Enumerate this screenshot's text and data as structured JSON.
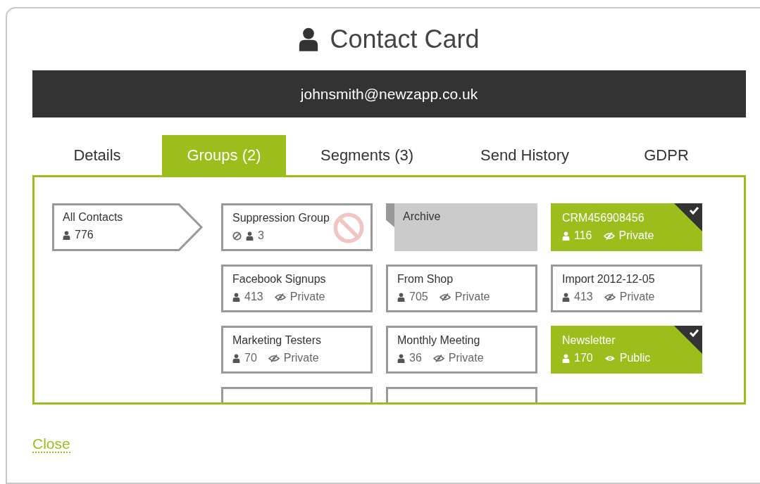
{
  "title": "Contact Card",
  "email": "johnsmith@newzapp.co.uk",
  "tabs": [
    {
      "label": "Details",
      "selected": false
    },
    {
      "label": "Groups (2)",
      "selected": true
    },
    {
      "label": "Segments (3)",
      "selected": false
    },
    {
      "label": "Send History",
      "selected": false
    },
    {
      "label": "GDPR",
      "selected": false
    }
  ],
  "all_contacts": {
    "name": "All Contacts",
    "count": "776"
  },
  "groups": [
    {
      "kind": "suppression",
      "name": "Suppression Group",
      "count": "3",
      "selected": false
    },
    {
      "kind": "archive",
      "name": "Archive"
    },
    {
      "kind": "group",
      "name": "CRM456908456",
      "count": "116",
      "visibility": "Private",
      "public": false,
      "selected": true
    },
    {
      "kind": "group",
      "name": "Facebook Signups",
      "count": "413",
      "visibility": "Private",
      "public": false,
      "selected": false
    },
    {
      "kind": "group",
      "name": "From Shop",
      "count": "705",
      "visibility": "Private",
      "public": false,
      "selected": false
    },
    {
      "kind": "group",
      "name": "Import 2012-12-05",
      "count": "413",
      "visibility": "Private",
      "public": false,
      "selected": false
    },
    {
      "kind": "group",
      "name": "Marketing Testers",
      "count": "70",
      "visibility": "Private",
      "public": false,
      "selected": false
    },
    {
      "kind": "group",
      "name": "Monthly Meeting",
      "count": "36",
      "visibility": "Private",
      "public": false,
      "selected": false
    },
    {
      "kind": "group",
      "name": "Newsletter",
      "count": "170",
      "visibility": "Public",
      "public": true,
      "selected": true
    },
    {
      "kind": "group",
      "selected": false
    },
    {
      "kind": "group",
      "selected": false
    }
  ],
  "close": "Close"
}
